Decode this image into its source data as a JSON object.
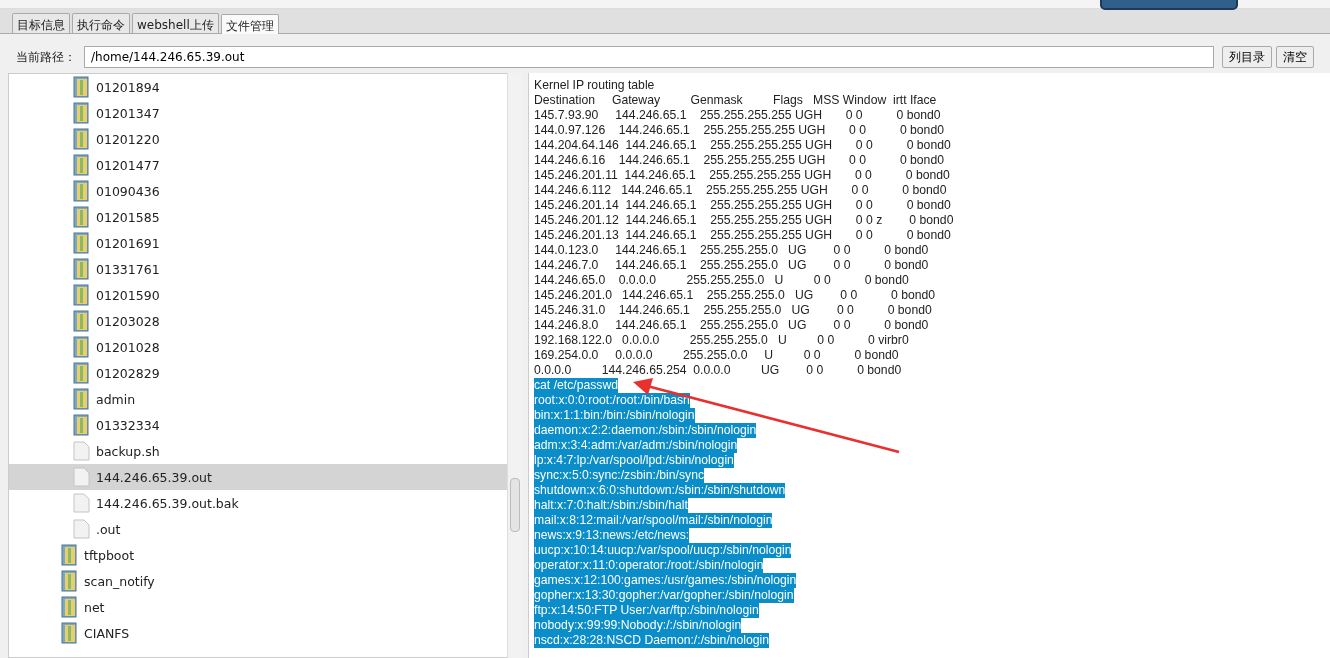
{
  "tabs": [
    {
      "label": "目标信息",
      "selected": false
    },
    {
      "label": "执行命令",
      "selected": false
    },
    {
      "label": "webshell上传",
      "selected": false
    },
    {
      "label": "文件管理",
      "selected": true
    }
  ],
  "path_bar": {
    "label": "当前路径：",
    "value": "/home/144.246.65.39.out",
    "buttons": [
      "列目录",
      "清空"
    ]
  },
  "tree": {
    "items": [
      {
        "kind": "group",
        "children": [
          {
            "kind": "folder",
            "name": "01201894",
            "selected": false
          },
          {
            "kind": "folder",
            "name": "01201347",
            "selected": false
          },
          {
            "kind": "folder",
            "name": "01201220",
            "selected": false
          },
          {
            "kind": "folder",
            "name": "01201477",
            "selected": false
          },
          {
            "kind": "folder",
            "name": "01090436",
            "selected": false
          },
          {
            "kind": "folder",
            "name": "01201585",
            "selected": false
          },
          {
            "kind": "folder",
            "name": "01201691",
            "selected": false
          },
          {
            "kind": "folder",
            "name": "01331761",
            "selected": false
          },
          {
            "kind": "folder",
            "name": "01201590",
            "selected": false
          },
          {
            "kind": "folder",
            "name": "01203028",
            "selected": false
          },
          {
            "kind": "folder",
            "name": "01201028",
            "selected": false
          },
          {
            "kind": "folder",
            "name": "01202829",
            "selected": false
          },
          {
            "kind": "folder",
            "name": "admin",
            "selected": false
          },
          {
            "kind": "folder",
            "name": "01332334",
            "selected": false
          },
          {
            "kind": "file",
            "name": "backup.sh",
            "selected": false
          },
          {
            "kind": "file",
            "name": "144.246.65.39.out",
            "selected": true
          },
          {
            "kind": "file",
            "name": "144.246.65.39.out.bak",
            "selected": false
          },
          {
            "kind": "file",
            "name": ".out",
            "selected": false
          }
        ]
      },
      {
        "kind": "folder",
        "name": "tftpboot",
        "selected": false
      },
      {
        "kind": "folder",
        "name": "scan_notify",
        "selected": false
      },
      {
        "kind": "folder",
        "name": "net",
        "selected": false
      },
      {
        "kind": "folder",
        "name": "CIANFS",
        "selected": false
      }
    ]
  },
  "output": {
    "lines": [
      {
        "text": "Kernel IP routing table",
        "selected": false
      },
      {
        "text": "Destination     Gateway         Genmask         Flags   MSS Window  irtt Iface",
        "selected": false
      },
      {
        "text": "145.7.93.90     144.246.65.1    255.255.255.255 UGH       0 0          0 bond0",
        "selected": false
      },
      {
        "text": "144.0.97.126    144.246.65.1    255.255.255.255 UGH       0 0          0 bond0",
        "selected": false
      },
      {
        "text": "144.204.64.146  144.246.65.1    255.255.255.255 UGH       0 0          0 bond0",
        "selected": false
      },
      {
        "text": "144.246.6.16    144.246.65.1    255.255.255.255 UGH       0 0          0 bond0",
        "selected": false
      },
      {
        "text": "145.246.201.11  144.246.65.1    255.255.255.255 UGH       0 0          0 bond0",
        "selected": false
      },
      {
        "text": "144.246.6.112   144.246.65.1    255.255.255.255 UGH       0 0          0 bond0",
        "selected": false
      },
      {
        "text": "145.246.201.14  144.246.65.1    255.255.255.255 UGH       0 0          0 bond0",
        "selected": false
      },
      {
        "text": "145.246.201.12  144.246.65.1    255.255.255.255 UGH       0 0 z        0 bond0",
        "selected": false
      },
      {
        "text": "145.246.201.13  144.246.65.1    255.255.255.255 UGH       0 0          0 bond0",
        "selected": false
      },
      {
        "text": "144.0.123.0     144.246.65.1    255.255.255.0   UG        0 0          0 bond0",
        "selected": false
      },
      {
        "text": "144.246.7.0     144.246.65.1    255.255.255.0   UG        0 0          0 bond0",
        "selected": false
      },
      {
        "text": "144.246.65.0    0.0.0.0         255.255.255.0   U         0 0          0 bond0",
        "selected": false
      },
      {
        "text": "145.246.201.0   144.246.65.1    255.255.255.0   UG        0 0          0 bond0",
        "selected": false
      },
      {
        "text": "145.246.31.0    144.246.65.1    255.255.255.0   UG        0 0          0 bond0",
        "selected": false
      },
      {
        "text": "144.246.8.0     144.246.65.1    255.255.255.0   UG        0 0          0 bond0",
        "selected": false
      },
      {
        "text": "192.168.122.0   0.0.0.0         255.255.255.0   U         0 0          0 virbr0",
        "selected": false
      },
      {
        "text": "169.254.0.0     0.0.0.0         255.255.0.0     U         0 0          0 bond0",
        "selected": false
      },
      {
        "text": "0.0.0.0         144.246.65.254  0.0.0.0         UG        0 0          0 bond0",
        "selected": false
      },
      {
        "text": "cat /etc/passwd",
        "selected": true
      },
      {
        "text": "root:x:0:0:root:/root:/bin/bash",
        "selected": true
      },
      {
        "text": "bin:x:1:1:bin:/bin:/sbin/nologin",
        "selected": true
      },
      {
        "text": "daemon:x:2:2:daemon:/sbin:/sbin/nologin",
        "selected": true
      },
      {
        "text": "adm:x:3:4:adm:/var/adm:/sbin/nologin",
        "selected": true
      },
      {
        "text": "lp:x:4:7:lp:/var/spool/lpd:/sbin/nologin",
        "selected": true
      },
      {
        "text": "sync:x:5:0:sync:/zsbin:/bin/sync",
        "selected": true
      },
      {
        "text": "shutdown:x:6:0:shutdown:/sbin:/sbin/shutdown",
        "selected": true
      },
      {
        "text": "halt:x:7:0:halt:/sbin:/sbin/halt",
        "selected": true
      },
      {
        "text": "mail:x:8:12:mail:/var/spool/mail:/sbin/nologin",
        "selected": true
      },
      {
        "text": "news:x:9:13:news:/etc/news:",
        "selected": true
      },
      {
        "text": "uucp:x:10:14:uucp:/var/spool/uucp:/sbin/nologin",
        "selected": true
      },
      {
        "text": "operator:x:11:0:operator:/root:/sbin/nologin",
        "selected": true
      },
      {
        "text": "games:x:12:100:games:/usr/games:/sbin/nologin",
        "selected": true
      },
      {
        "text": "gopher:x:13:30:gopher:/var/gopher:/sbin/nologin",
        "selected": true
      },
      {
        "text": "ftp:x:14:50:FTP User:/var/ftp:/sbin/nologin",
        "selected": true
      },
      {
        "text": "nobody:x:99:99:Nobody:/:/sbin/nologin",
        "selected": true
      },
      {
        "text": "nscd:x:28:28:NSCD Daemon:/:/sbin/nologin",
        "selected": true
      }
    ]
  }
}
